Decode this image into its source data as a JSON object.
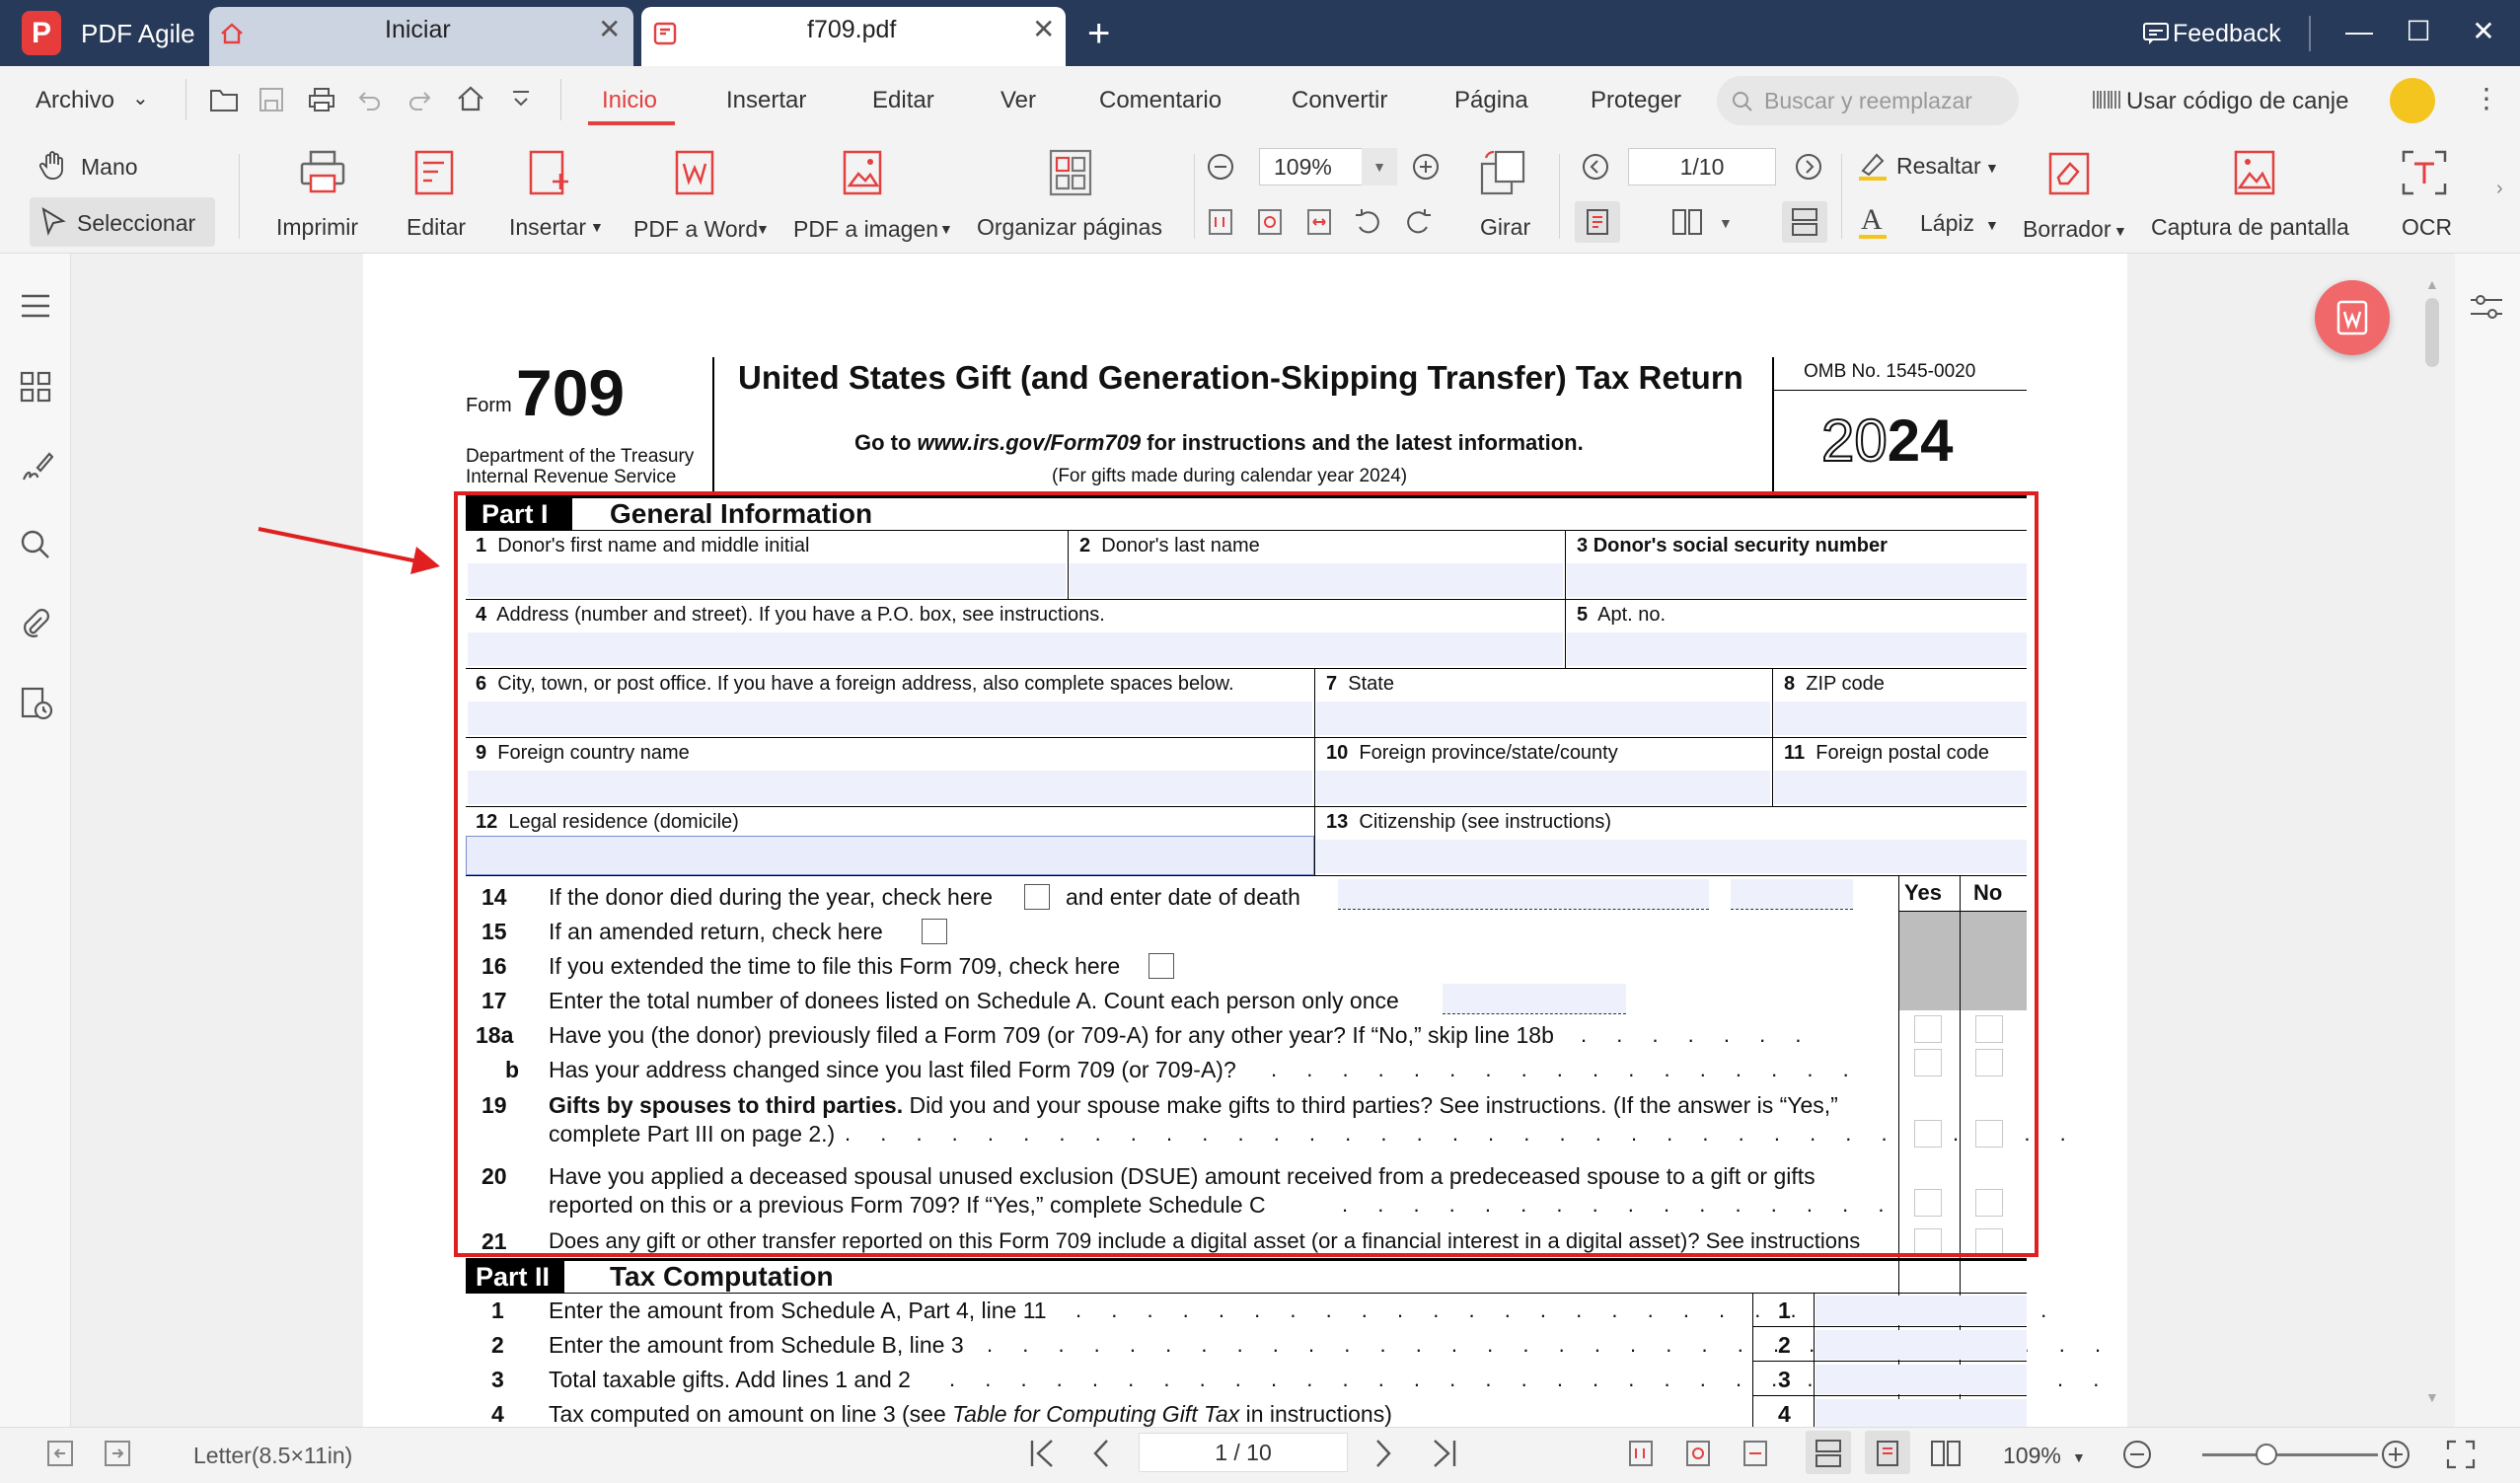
{
  "app": {
    "name": "PDF Agile",
    "logo_letter": "P"
  },
  "tabs": [
    {
      "label": "Iniciar"
    },
    {
      "label": "f709.pdf"
    }
  ],
  "titlebar": {
    "feedback": "Feedback"
  },
  "menu": {
    "file": "Archivo",
    "items": [
      "Inicio",
      "Insertar",
      "Editar",
      "Ver",
      "Comentario",
      "Convertir",
      "Página",
      "Proteger"
    ],
    "search_placeholder": "Buscar y reemplazar",
    "redeem": "Usar código de canje"
  },
  "toolbar": {
    "hand": "Mano",
    "select": "Seleccionar",
    "print": "Imprimir",
    "edit": "Editar",
    "insert": "Insertar",
    "pdf_to_word": "PDF a Word",
    "pdf_to_image": "PDF a imagen",
    "organize": "Organizar páginas",
    "zoom": "109%",
    "page": "1/10",
    "rotate": "Girar",
    "highlight": "Resaltar",
    "pencil": "Lápiz",
    "eraser": "Borrador",
    "screenshot": "Captura de pantalla",
    "ocr": "OCR"
  },
  "form": {
    "form_word": "Form",
    "form_number": "709",
    "dept1": "Department of the Treasury",
    "dept2": "Internal Revenue Service",
    "title": "United States Gift (and Generation-Skipping Transfer) Tax Return",
    "goto_prefix": "Go to ",
    "goto_url": "www.irs.gov/Form709",
    "goto_suffix": " for instructions and the latest information.",
    "subtitle": "(For gifts made during calendar year 2024)",
    "omb": "OMB No. 1545-0020",
    "year_prefix": "20",
    "year_bold": "24",
    "part1_tag": "Part I",
    "part1_title": "General Information",
    "fields": {
      "f1": "Donor's first name and middle initial",
      "f2": "Donor's last name",
      "f3": "Donor's social security number",
      "f4": "Address (number and street). If you have a P.O. box, see instructions.",
      "f5": "Apt. no.",
      "f6": "City, town, or post office. If you have a foreign address, also complete spaces below.",
      "f7": "State",
      "f8": "ZIP code",
      "f9": "Foreign country name",
      "f10": "Foreign province/state/county",
      "f11": "Foreign postal code",
      "f12": "Legal residence (domicile)",
      "f13": "Citizenship (see instructions)"
    },
    "yes": "Yes",
    "no": "No",
    "lines": {
      "l14": "If the donor died during the year, check here",
      "l14b": "and enter date of death",
      "l15": "If an amended return, check here",
      "l16": "If you extended the time to file this Form 709, check here",
      "l17": "Enter the total number of donees listed on Schedule A. Count each person only once",
      "l18a": "Have you (the donor) previously filed a Form 709 (or 709-A) for any other year? If “No,” skip line 18b",
      "l18b": "Has your address changed since you last filed Form 709 (or 709-A)?",
      "l19_bold": "Gifts by spouses to third parties.",
      "l19": " Did you and your spouse make gifts to third parties? See instructions. (If the answer is “Yes,”",
      "l19c": "complete Part III on page 2.)",
      "l20": "Have you applied a deceased spousal unused exclusion (DSUE) amount received from a predeceased spouse to a gift or gifts",
      "l20c": "reported on this or a previous Form 709? If “Yes,” complete Schedule C",
      "l21": "Does any gift or other transfer reported on this Form 709 include a digital asset (or a financial interest in a digital asset)? See instructions"
    },
    "part2_tag": "Part II",
    "part2_title": "Tax Computation",
    "p2lines": [
      {
        "num": "1",
        "text": "Enter the amount from Schedule A, Part 4, line 11"
      },
      {
        "num": "2",
        "text": "Enter the amount from Schedule B, line 3"
      },
      {
        "num": "3",
        "text": "Total taxable gifts. Add lines 1 and 2"
      },
      {
        "num": "4",
        "text_pre": "Tax computed on amount on line 3 (see ",
        "text_em": "Table for Computing Gift Tax",
        "text_post": " in instructions)"
      }
    ]
  },
  "status": {
    "paper": "Letter(8.5×11in)",
    "page": "1 / 10",
    "zoom": "109%"
  },
  "colors": {
    "titlebar": "#283a5a",
    "accent": "#e34040",
    "highlight_box": "#e02020"
  }
}
